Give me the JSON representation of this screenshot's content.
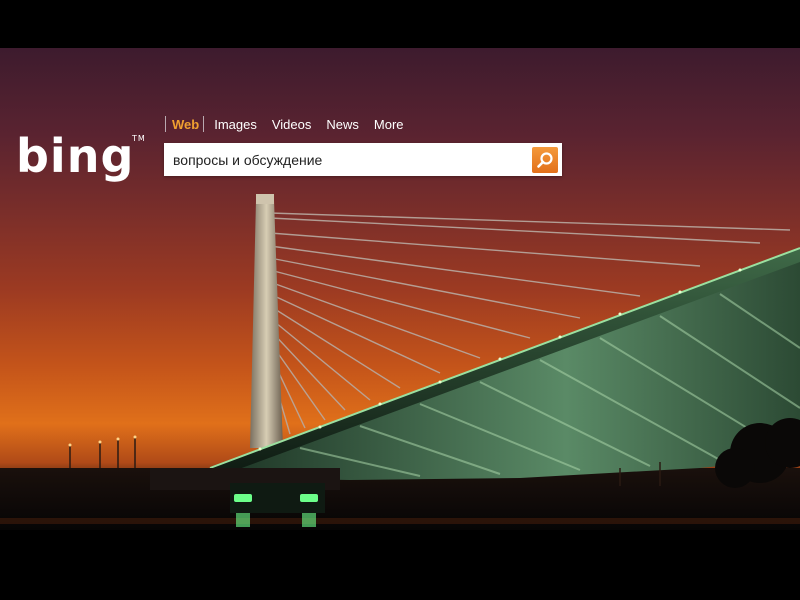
{
  "brand": {
    "logo_text": "bing",
    "trademark": "TM"
  },
  "nav": {
    "items": [
      {
        "label": "Web",
        "active": true
      },
      {
        "label": "Images",
        "active": false
      },
      {
        "label": "Videos",
        "active": false
      },
      {
        "label": "News",
        "active": false
      },
      {
        "label": "More",
        "active": false
      }
    ]
  },
  "search": {
    "value": "вопросы и обсуждение",
    "button_icon": "search-icon"
  },
  "background": {
    "subject": "cable-stayed bridge at sunset",
    "sky_colors": [
      "#3d1b2e",
      "#9c3a22",
      "#e0701a"
    ],
    "bridge_light_color": "#7fdc8a"
  },
  "colors": {
    "active_nav": "#f0a030",
    "search_button": "#e98a2a"
  }
}
